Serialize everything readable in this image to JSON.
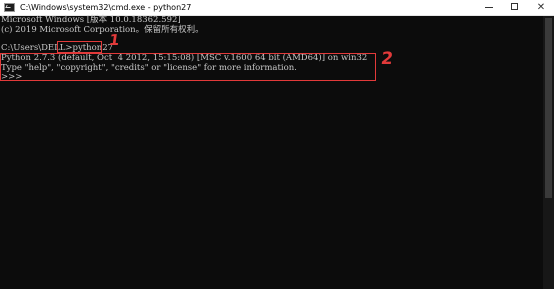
{
  "window": {
    "title": "C:\\Windows\\system32\\cmd.exe - python27",
    "icon": "cmd-icon",
    "controls": {
      "minimize": "minimize-icon",
      "maximize": "maximize-icon",
      "close": "close-icon",
      "close_glyph": "✕"
    }
  },
  "console": {
    "lines": [
      "Microsoft Windows [版本 10.0.18362.592]",
      "(c) 2019 Microsoft Corporation。保留所有权利。",
      "",
      "C:\\Users\\DELL>python27",
      "Python 2.7.3 (default, Oct  4 2012, 15:15:08) [MSC v.1600 64 bit (AMD64)] on win32",
      "Type \"help\", \"copyright\", \"credits\" or \"license\" for more information.",
      ">>>"
    ],
    "colors": {
      "background": "#0c0c0c",
      "text": "#c8c8c8"
    }
  },
  "annotations": {
    "label_1": "1",
    "label_2": "2",
    "color": "#e23a3a"
  }
}
